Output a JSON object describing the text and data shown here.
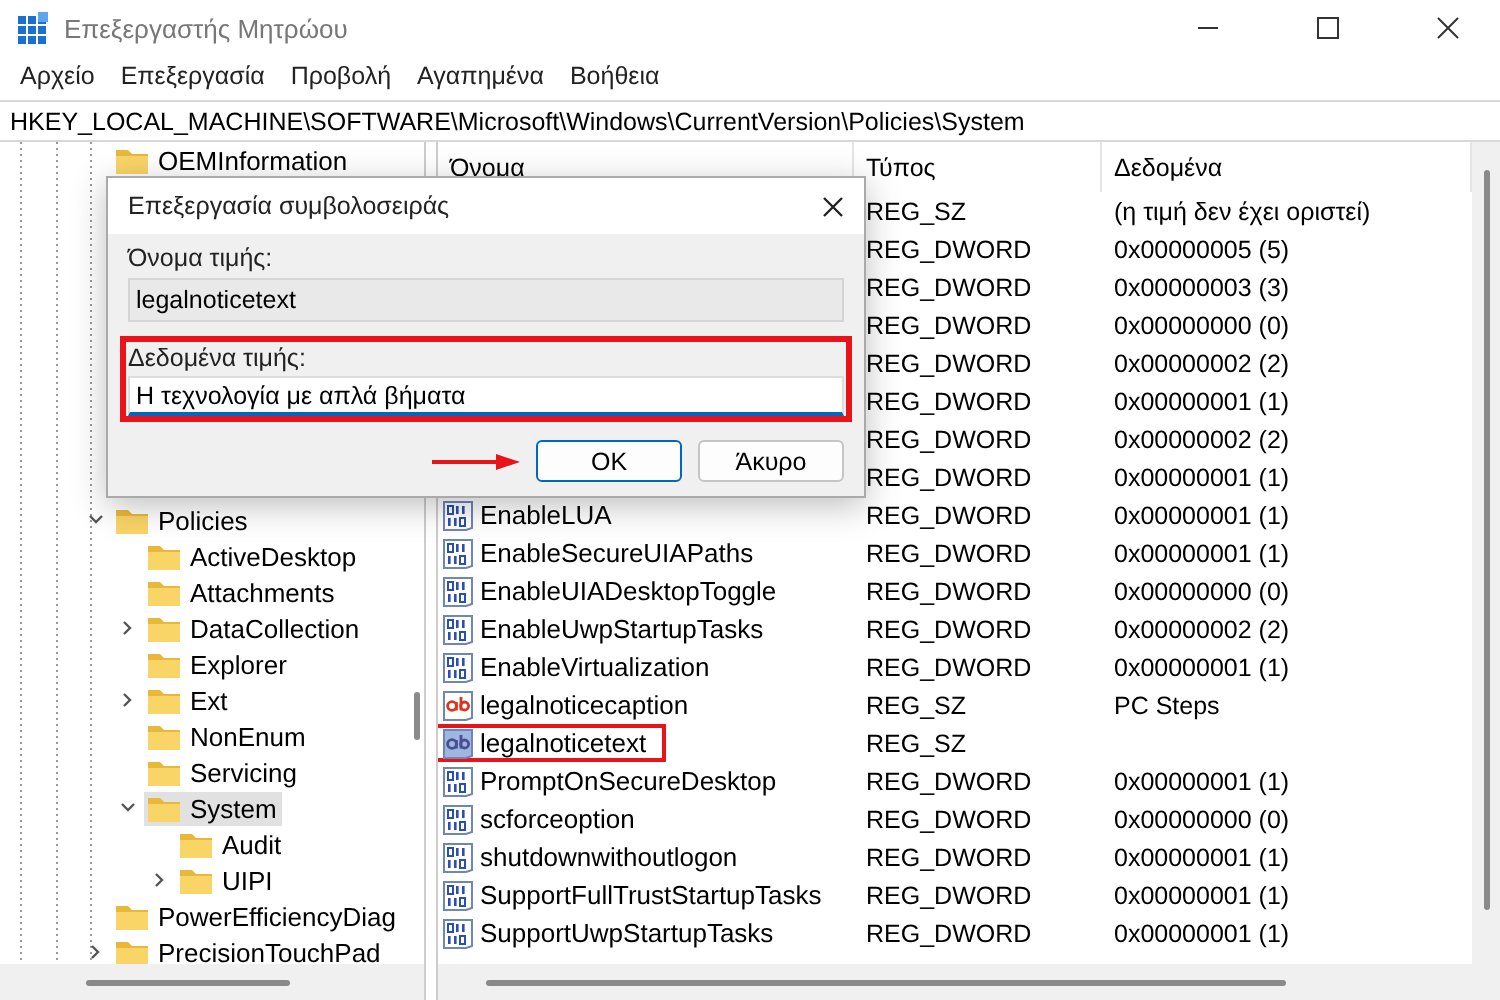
{
  "window": {
    "title": "Επεξεργαστής Μητρώου"
  },
  "menu": [
    "Αρχείο",
    "Επεξεργασία",
    "Προβολή",
    "Αγαπημένα",
    "Βοήθεια"
  ],
  "address": "HKEY_LOCAL_MACHINE\\SOFTWARE\\Microsoft\\Windows\\CurrentVersion\\Policies\\System",
  "tree": [
    {
      "label": "OEMInformation",
      "selected": false
    },
    {
      "label": "Policies",
      "selected": false,
      "expanded": true,
      "children": [
        {
          "label": "ActiveDesktop",
          "selected": false
        },
        {
          "label": "Attachments",
          "selected": false
        },
        {
          "label": "DataCollection",
          "selected": false,
          "expanded": false
        },
        {
          "label": "Explorer",
          "selected": false
        },
        {
          "label": "Ext",
          "selected": false,
          "expanded": false
        },
        {
          "label": "NonEnum",
          "selected": false
        },
        {
          "label": "Servicing",
          "selected": false
        },
        {
          "label": "System",
          "selected": true,
          "expanded": true,
          "children": [
            {
              "label": "Audit",
              "selected": false
            },
            {
              "label": "UIPI",
              "selected": false,
              "expanded": false
            }
          ]
        }
      ]
    },
    {
      "label": "PowerEfficiencyDiag",
      "selected": false
    },
    {
      "label": "PrecisionTouchPad",
      "selected": false,
      "expanded": false
    }
  ],
  "table": {
    "columns": [
      "Όνομα",
      "Τύπος",
      "Δεδομένα"
    ],
    "rows": [
      {
        "type": "REG_SZ",
        "data": "(η τιμή δεν έχει οριστεί)"
      },
      {
        "type": "REG_DWORD",
        "data": "0x00000005 (5)"
      },
      {
        "type": "REG_DWORD",
        "data": "0x00000003 (3)"
      },
      {
        "type": "REG_DWORD",
        "data": "0x00000000 (0)"
      },
      {
        "type": "REG_DWORD",
        "data": "0x00000002 (2)"
      },
      {
        "type": "REG_DWORD",
        "data": "0x00000001 (1)"
      },
      {
        "type": "REG_DWORD",
        "data": "0x00000002 (2)"
      },
      {
        "type": "REG_DWORD",
        "data": "0x00000001 (1)"
      },
      {
        "kind": "dword",
        "name": "EnableLUA",
        "type": "REG_DWORD",
        "data": "0x00000001 (1)",
        "selected": false,
        "highlighted": false
      },
      {
        "kind": "dword",
        "name": "EnableSecureUIAPaths",
        "type": "REG_DWORD",
        "data": "0x00000001 (1)",
        "selected": false,
        "highlighted": false
      },
      {
        "kind": "dword",
        "name": "EnableUIADesktopToggle",
        "type": "REG_DWORD",
        "data": "0x00000000 (0)",
        "selected": false,
        "highlighted": false
      },
      {
        "kind": "dword",
        "name": "EnableUwpStartupTasks",
        "type": "REG_DWORD",
        "data": "0x00000002 (2)",
        "selected": false,
        "highlighted": false
      },
      {
        "kind": "dword",
        "name": "EnableVirtualization",
        "type": "REG_DWORD",
        "data": "0x00000001 (1)",
        "selected": false,
        "highlighted": false
      },
      {
        "kind": "sz",
        "name": "legalnoticecaption",
        "type": "REG_SZ",
        "data": "PC Steps",
        "selected": false,
        "highlighted": false
      },
      {
        "kind": "sz",
        "name": "legalnoticetext",
        "type": "REG_SZ",
        "selected": true,
        "highlighted": true
      },
      {
        "kind": "dword",
        "name": "PromptOnSecureDesktop",
        "type": "REG_DWORD",
        "data": "0x00000001 (1)",
        "selected": false,
        "highlighted": false
      },
      {
        "kind": "dword",
        "name": "scforceoption",
        "type": "REG_DWORD",
        "data": "0x00000000 (0)",
        "selected": false,
        "highlighted": false
      },
      {
        "kind": "dword",
        "name": "shutdownwithoutlogon",
        "type": "REG_DWORD",
        "data": "0x00000001 (1)",
        "selected": false,
        "highlighted": false
      },
      {
        "kind": "dword",
        "name": "SupportFullTrustStartupTasks",
        "type": "REG_DWORD",
        "data": "0x00000001 (1)",
        "selected": false,
        "highlighted": false
      },
      {
        "kind": "dword",
        "name": "SupportUwpStartupTasks",
        "type": "REG_DWORD",
        "data": "0x00000001 (1)",
        "selected": false,
        "highlighted": false
      }
    ]
  },
  "dialog": {
    "title": "Επεξεργασία συμβολοσειράς",
    "name_label": "Όνομα τιμής:",
    "name_value": "legalnoticetext",
    "data_label": "Δεδομένα τιμής:",
    "data_value": "Η τεχνολογία με απλά βήματα",
    "data_highlighted": true,
    "buttons": [
      {
        "label": "OK",
        "default": true,
        "pointed": true
      },
      {
        "label": "Άκυρο",
        "default": false,
        "pointed": false
      }
    ]
  }
}
